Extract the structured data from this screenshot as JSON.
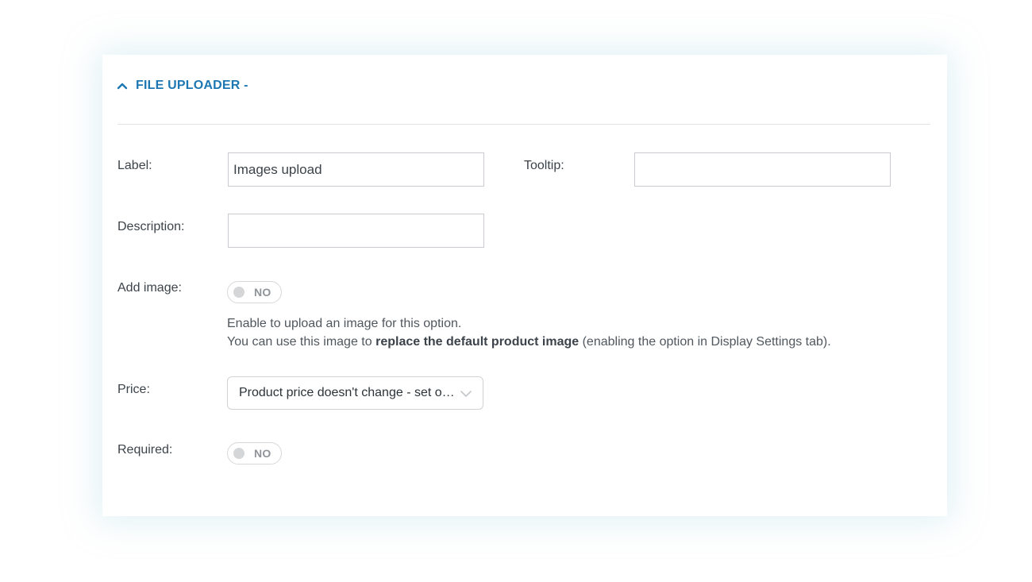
{
  "section": {
    "title": "FILE UPLOADER -",
    "chevron_icon": "chevron-up-icon",
    "accent_color": "#1d77b2"
  },
  "fields": {
    "label": {
      "label": "Label:",
      "value": "Images upload"
    },
    "tooltip": {
      "label": "Tooltip:",
      "value": ""
    },
    "description": {
      "label": "Description:",
      "value": ""
    },
    "add_image": {
      "label": "Add image:",
      "toggle_text": "NO",
      "help_line1": "Enable to upload an image for this option.",
      "help_line2_prefix": "You can use this image to ",
      "help_line2_bold": "replace the default product image",
      "help_line2_suffix": " (enabling the option in Display Settings tab)."
    },
    "price": {
      "label": "Price:",
      "selected": "Product price doesn't change - set option price here",
      "arrow_icon": "chevron-down-icon"
    },
    "required": {
      "label": "Required:",
      "toggle_text": "NO"
    }
  }
}
